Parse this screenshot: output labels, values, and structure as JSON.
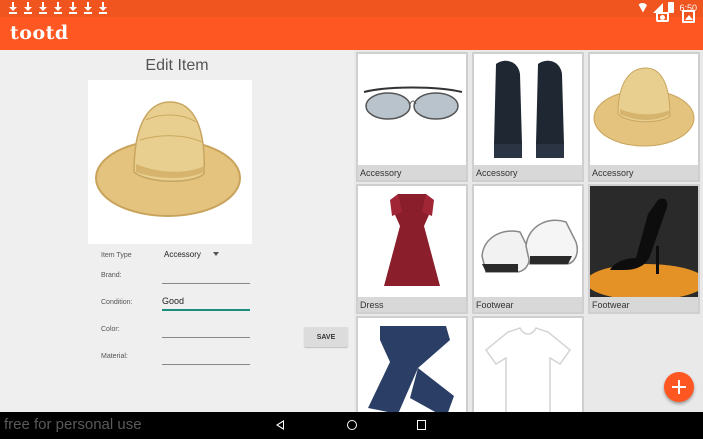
{
  "app": {
    "logo": "tootd"
  },
  "status": {
    "time": "6:50"
  },
  "edit": {
    "title": "Edit Item",
    "fields": [
      {
        "label": "Item Type",
        "value": "Accessory"
      },
      {
        "label": "Brand:",
        "value": ""
      },
      {
        "label": "Condition:",
        "value": "Good"
      },
      {
        "label": "Color:",
        "value": ""
      },
      {
        "label": "Material:",
        "value": ""
      }
    ],
    "save_label": "SAVE"
  },
  "items": [
    {
      "category": "Accessory",
      "image": "sunglasses"
    },
    {
      "category": "Accessory",
      "image": "gloves"
    },
    {
      "category": "Accessory",
      "image": "straw-hat"
    },
    {
      "category": "Dress",
      "image": "red-dress"
    },
    {
      "category": "Footwear",
      "image": "sneakers"
    },
    {
      "category": "Footwear",
      "image": "black-heel"
    },
    {
      "category": "",
      "image": "jeans"
    },
    {
      "category": "",
      "image": "white-tshirt"
    }
  ],
  "nav": {
    "watermark": "free for personal use"
  },
  "colors": {
    "primary": "#ff5722",
    "status_bar": "#f0541f",
    "accent": "#1a8f7e"
  }
}
